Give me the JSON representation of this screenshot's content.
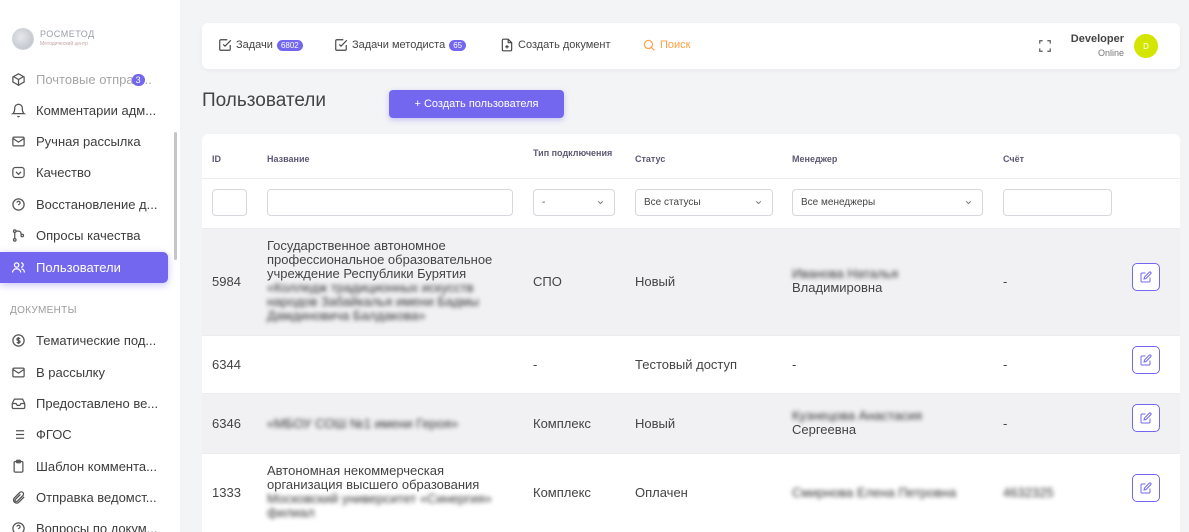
{
  "app": {
    "logo_text": "РОСМЕТОД",
    "logo_subtext": "Методический центр"
  },
  "colors": {
    "accent": "#7367f0",
    "search": "#ff9f43",
    "avatar": "#d4e600"
  },
  "sidebar": {
    "items": [
      {
        "label": "Почтовые отпра",
        "badge": "3",
        "icon": "box-icon",
        "dim": true
      },
      {
        "label": "Комментарии адм...",
        "icon": "bell-icon"
      },
      {
        "label": "Ручная рассылка",
        "icon": "mail-icon"
      },
      {
        "label": "Качество",
        "icon": "shield-check-icon"
      },
      {
        "label": "Восстановление д...",
        "icon": "help-circle-icon"
      },
      {
        "label": "Опросы качества",
        "icon": "git-merge-icon"
      },
      {
        "label": "Пользователи",
        "icon": "users-icon",
        "active": true
      }
    ],
    "section_label": "ДОКУМЕНТЫ",
    "doc_items": [
      {
        "label": "Тематические под...",
        "icon": "dollar-circle-icon"
      },
      {
        "label": "В рассылку",
        "icon": "mail-icon"
      },
      {
        "label": "Предоставлено ве...",
        "icon": "inbox-icon"
      },
      {
        "label": "ФГОС",
        "icon": "list-icon"
      },
      {
        "label": "Шаблон коммента...",
        "icon": "clipboard-icon"
      },
      {
        "label": "Отправка ведомст...",
        "icon": "paperclip-icon"
      },
      {
        "label": "Вопросы по докум...",
        "icon": "help-circle-icon"
      }
    ]
  },
  "topbar": {
    "tasks_label": "Задачи",
    "tasks_count": "6802",
    "methodist_label": "Задачи методиста",
    "methodist_count": "65",
    "create_doc_label": "Создать документ",
    "search_label": "Поиск",
    "user_name": "Developer",
    "user_status": "Online",
    "avatar_initial": "D"
  },
  "page": {
    "title": "Пользователи",
    "create_button": "+ Создать пользователя"
  },
  "table": {
    "headers": {
      "id": "ID",
      "name": "Название",
      "conn_type": "Тип подключения",
      "status": "Статус",
      "manager": "Менеджер",
      "account": "Счёт"
    },
    "filters": {
      "conn_type": "-",
      "status": "Все статусы",
      "manager": "Все менеджеры"
    },
    "rows": [
      {
        "id": "5984",
        "name_visible": "Государственное автономное профессиональное образовательное учреждение Республики Бурятия",
        "name_hidden": "«Колледж традиционных искусств народов Забайкалья имени Бадмы Дамдиновича Балдакова»",
        "conn_type": "СПО",
        "status": "Новый",
        "manager_hidden": "Иванова Наталья",
        "manager_visible": "Владимировна",
        "account": "-"
      },
      {
        "id": "6344",
        "name_visible": "",
        "conn_type": "-",
        "status": "Тестовый доступ",
        "manager_visible": "-",
        "account": "-"
      },
      {
        "id": "6346",
        "name_hidden": "«МБОУ СОШ №1 имени Героя»",
        "conn_type": "Комплекс",
        "status": "Новый",
        "manager_hidden": "Кузнецова Анастасия",
        "manager_visible": "Сергеевна",
        "account": "-"
      },
      {
        "id": "1333",
        "name_visible": "Автономная некоммерческая организация высшего образования",
        "name_hidden": "Московский университет «Синергия» филиал",
        "conn_type": "Комплекс",
        "status": "Оплачен",
        "manager_hidden": "Смирнова Елена Петровна",
        "account": "4632325"
      }
    ]
  }
}
